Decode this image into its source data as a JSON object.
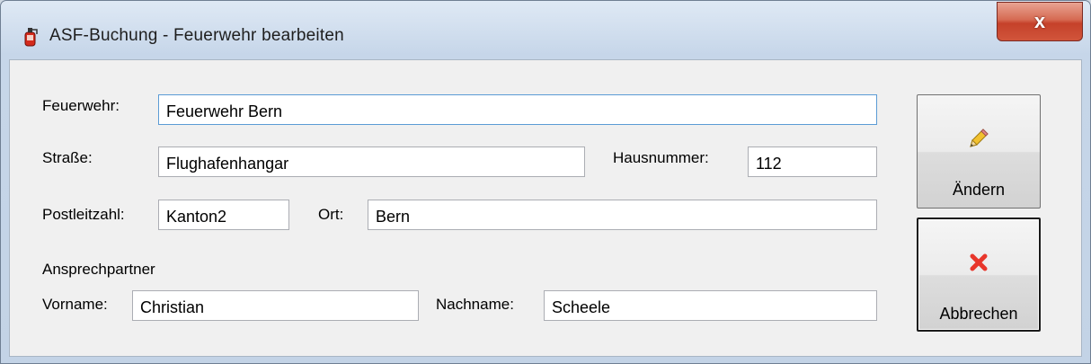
{
  "window": {
    "title": "ASF-Buchung - Feuerwehr bearbeiten",
    "close_label": "x"
  },
  "form": {
    "feuerwehr": {
      "label": "Feuerwehr:",
      "value": "Feuerwehr Bern"
    },
    "strasse": {
      "label": "Straße:",
      "value": "Flughafenhangar"
    },
    "hausnummer": {
      "label": "Hausnummer:",
      "value": "112"
    },
    "postleitzahl": {
      "label": "Postleitzahl:",
      "value": "Kanton2"
    },
    "ort": {
      "label": "Ort:",
      "value": "Bern"
    },
    "contact_heading": "Ansprechpartner",
    "vorname": {
      "label": "Vorname:",
      "value": "Christian"
    },
    "nachname": {
      "label": "Nachname:",
      "value": "Scheele"
    }
  },
  "buttons": {
    "aendern": {
      "label": "Ändern",
      "icon": "pencil-icon"
    },
    "abbrechen": {
      "label": "Abbrechen",
      "icon": "close-x-icon"
    }
  },
  "colors": {
    "icon_red": "#e8362b",
    "pencil_yellow": "#f2c12e"
  }
}
